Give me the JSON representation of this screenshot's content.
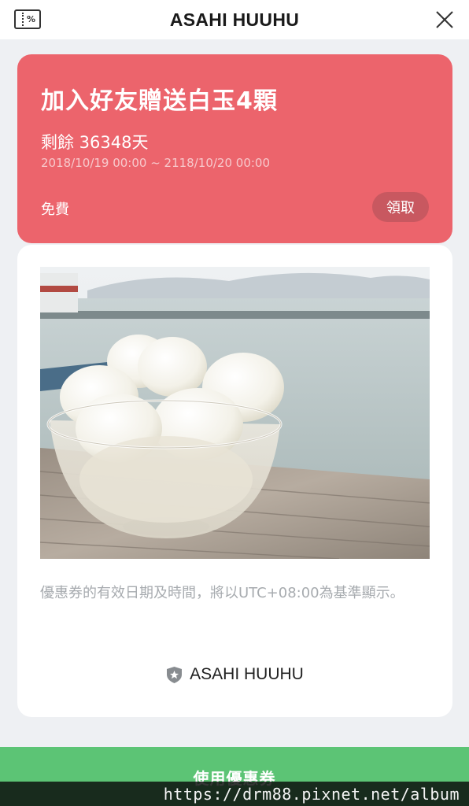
{
  "header": {
    "title": "ASAHI HUUHU",
    "coupon_icon_label": "%",
    "left_icon": "coupon-icon",
    "right_icon": "close-icon"
  },
  "coupon": {
    "title": "加入好友贈送白玉4顆",
    "remaining": "剩餘  36348天",
    "validity": "2018/10/19 00:00 ~ 2118/10/20 00:00",
    "price": "免費",
    "claim_label": "領取",
    "color": "#ec646c"
  },
  "detail": {
    "photo": "white-rice-balls-in-glass-bowl",
    "notice": "優惠券的有效日期及時間，將以UTC+08:00為基準顯示。",
    "brand_icon": "shield-star-icon",
    "brand_name": "ASAHI HUUHU"
  },
  "footer": {
    "use_label": "使用優惠券",
    "color": "#5cc475"
  },
  "watermark": {
    "text": "https://drm88.pixnet.net/album"
  }
}
